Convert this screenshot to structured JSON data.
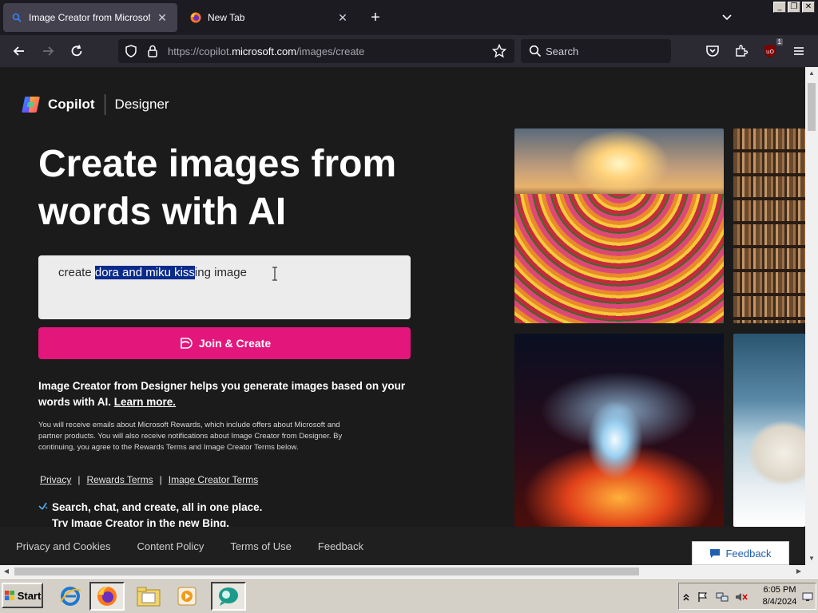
{
  "browser": {
    "tabs": [
      {
        "title": "Image Creator from Microsoft Designer",
        "active": true
      },
      {
        "title": "New Tab",
        "active": false
      }
    ],
    "new_tab_symbol": "+",
    "url_dim_prefix": "https://copilot.",
    "url_host": "microsoft.com",
    "url_path": "/images/create",
    "search_placeholder": "Search",
    "extension_badge": "1"
  },
  "header": {
    "brand_name": "Copilot",
    "product_name": "Designer"
  },
  "hero": {
    "headline": "Create images from words with AI"
  },
  "prompt": {
    "before_selection": "create ",
    "selected": "dora and miku kiss",
    "after_selection": "ing image"
  },
  "join_button": {
    "label": "Join & Create"
  },
  "description": {
    "text": "Image Creator from Designer helps you generate images based on your words with AI. ",
    "learn_more": "Learn more."
  },
  "legal": {
    "text": "You will receive emails about Microsoft Rewards, which include offers about Microsoft and partner products. You will also receive notifications about Image Creator from Designer. By continuing, you agree to the Rewards Terms and Image Creator Terms below."
  },
  "legal_links": [
    "Privacy",
    "Rewards Terms",
    "Image Creator Terms"
  ],
  "promo": {
    "line1": "Search, chat, and create, all in one place.",
    "line2": "Try Image Creator in the new Bing."
  },
  "footer": {
    "links": [
      "Privacy and Cookies",
      "Content Policy",
      "Terms of Use",
      "Feedback"
    ],
    "feedback_button": "Feedback"
  },
  "taskbar": {
    "start_label": "Start",
    "time": "6:05 PM",
    "date": "8/4/2024"
  },
  "colors": {
    "accent_pink": "#e3167c",
    "page_bg": "#1b1b1b",
    "selection_bg": "#0b2a8a"
  },
  "icons": [
    "search-icon",
    "firefox-icon",
    "back-arrow-icon",
    "forward-arrow-icon",
    "reload-icon",
    "shield-icon",
    "lock-icon",
    "star-icon",
    "pocket-icon",
    "extensions-icon",
    "ublock-icon",
    "menu-icon",
    "copilot-logo-icon",
    "designer-create-icon",
    "feedback-chat-icon",
    "windows-flag-icon",
    "ie-icon",
    "folder-icon",
    "media-player-icon",
    "chat-app-icon"
  ]
}
